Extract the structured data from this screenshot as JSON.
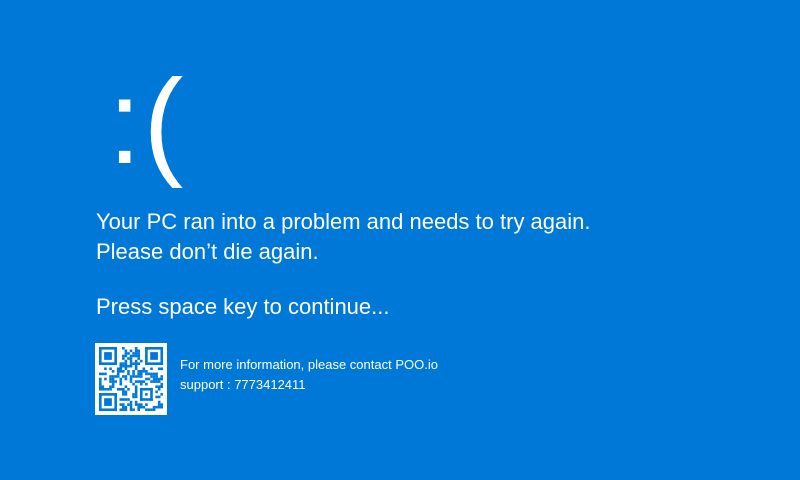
{
  "bsod": {
    "face": ":(",
    "message_line1": "Your PC ran into a problem and needs to try again.",
    "message_line2": "Please don’t die again.",
    "continue_prompt": "Press space key to continue...",
    "info_line": "For more information, please contact POO.io",
    "support_line": "support : 7773412411",
    "qr_icon": "qr-code-icon",
    "background_color": "#0078d7",
    "text_color": "#ffffff"
  }
}
